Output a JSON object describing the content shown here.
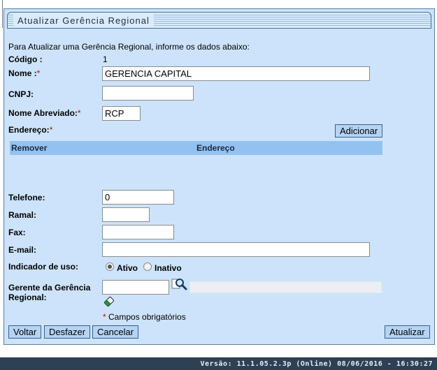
{
  "panel": {
    "title": "Atualizar Gerência Regional"
  },
  "intro": "Para Atualizar uma Gerência Regional, informe os dados abaixo:",
  "codigo": {
    "label": "Código :",
    "value": "1"
  },
  "nome": {
    "label": "Nome :",
    "required_mark": "*",
    "value": "GERENCIA CAPITAL"
  },
  "cnpj": {
    "label": "CNPJ:",
    "value": ""
  },
  "nome_abreviado": {
    "label": "Nome Abreviado:",
    "required_mark": "*",
    "value": "RCP"
  },
  "endereco": {
    "label": "Endereço:",
    "required_mark": "*",
    "add_button": "Adicionar",
    "columns": [
      "Remover",
      "Endereço"
    ]
  },
  "telefone": {
    "label": "Telefone:",
    "value": "0"
  },
  "ramal": {
    "label": "Ramal:",
    "value": ""
  },
  "fax": {
    "label": "Fax:",
    "value": ""
  },
  "email": {
    "label": "E-mail:",
    "value": ""
  },
  "indicador": {
    "label": "Indicador de uso:",
    "options": [
      "Ativo",
      "Inativo"
    ],
    "selected": "Ativo"
  },
  "gerente": {
    "label_line1": "Gerente da Gerência",
    "label_line2": "Regional:",
    "id_value": "",
    "name_value": ""
  },
  "required_note": {
    "mark": "*",
    "text": " Campos obrigatórios"
  },
  "buttons": {
    "voltar": "Voltar",
    "desfazer": "Desfazer",
    "cancelar": "Cancelar",
    "atualizar": "Atualizar"
  },
  "footer": "Versão: 11.1.05.2.3p (Online) 08/06/2016 - 16:30:27",
  "colors": {
    "panel_bg": "#cce3fb",
    "table_header": "#94c2f0",
    "button_bg": "#b5d3f3",
    "footer_bg": "#2e4154",
    "required": "#d00000"
  },
  "icons": [
    "search-magnifier-icon",
    "eraser-icon"
  ]
}
